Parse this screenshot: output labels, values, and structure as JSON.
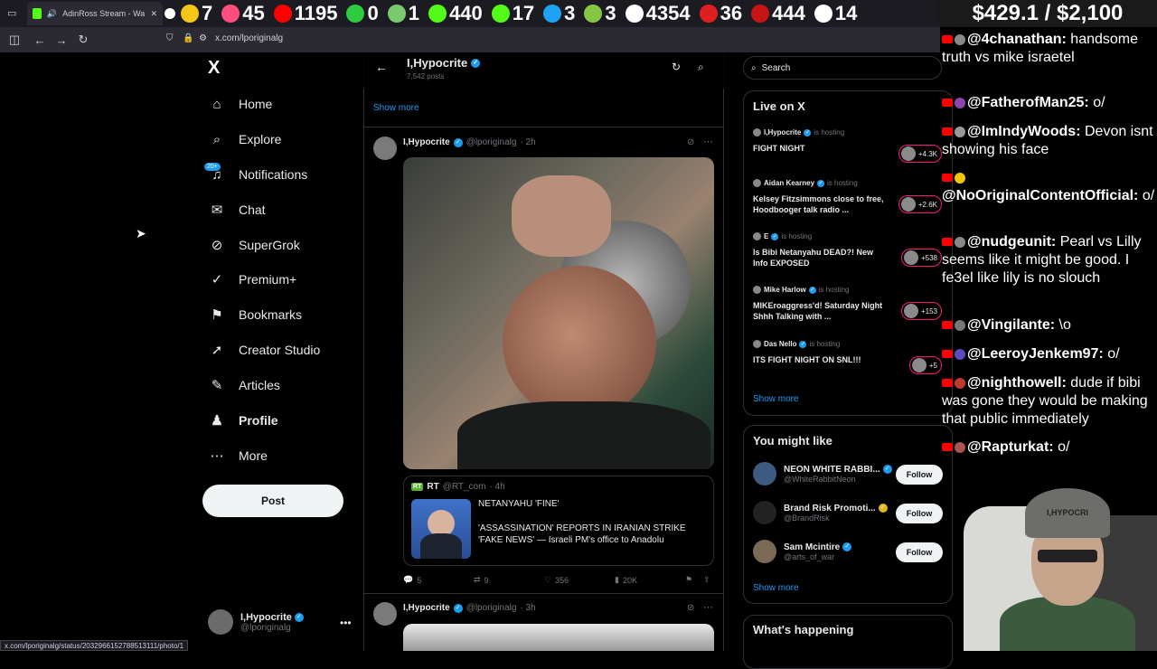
{
  "browser": {
    "active_tab_title": "AdinRoss Stream - Watch L",
    "url": "x.com/lporiginalg",
    "status_url": "x.com/lporiginalg/status/2032966152788513111/photo/1"
  },
  "overlay_stats": [
    {
      "icon": "smile-icon",
      "value": "7",
      "color": "#f5c518"
    },
    {
      "icon": "star-x-icon",
      "value": "45",
      "color": "#ff4d7e"
    },
    {
      "icon": "youtube-icon",
      "value": "1195",
      "color": "#ff0000"
    },
    {
      "icon": "plus-icon",
      "value": "0",
      "color": "#2ecc40"
    },
    {
      "icon": "globe-icon",
      "value": "1",
      "color": "#7bc96f"
    },
    {
      "icon": "play-icon",
      "value": "440",
      "color": "#53fc18"
    },
    {
      "icon": "kick-icon",
      "value": "17",
      "color": "#53fc18"
    },
    {
      "icon": "moon-icon",
      "value": "3",
      "color": "#1da1f2"
    },
    {
      "icon": "rumble-icon",
      "value": "3",
      "color": "#85c742"
    },
    {
      "icon": "x-icon",
      "value": "4354",
      "color": "#ffffff"
    },
    {
      "icon": "circle-icon",
      "value": "36",
      "color": "#e02020"
    },
    {
      "icon": "cross-icon",
      "value": "444",
      "color": "#c81414"
    },
    {
      "icon": "grid-icon",
      "value": "14",
      "color": "#ffffff"
    }
  ],
  "money": "$429.1 / $2,100",
  "nav": {
    "logo": "X",
    "items": [
      {
        "icon": "home-icon",
        "glyph": "⌂",
        "label": "Home"
      },
      {
        "icon": "search-icon",
        "glyph": "⌕",
        "label": "Explore"
      },
      {
        "icon": "bell-icon",
        "glyph": "♫",
        "label": "Notifications"
      },
      {
        "icon": "mail-icon",
        "glyph": "✉",
        "label": "Chat"
      },
      {
        "icon": "grok-icon",
        "glyph": "⊘",
        "label": "SuperGrok"
      },
      {
        "icon": "premium-icon",
        "glyph": "✓",
        "label": "Premium+"
      },
      {
        "icon": "bookmark-icon",
        "glyph": "⚑",
        "label": "Bookmarks"
      },
      {
        "icon": "rocket-icon",
        "glyph": "➚",
        "label": "Creator Studio"
      },
      {
        "icon": "articles-icon",
        "glyph": "✎",
        "label": "Articles"
      },
      {
        "icon": "person-icon",
        "glyph": "♟",
        "label": "Profile"
      },
      {
        "icon": "more-icon",
        "glyph": "⋯",
        "label": "More"
      }
    ],
    "notif_badge": "20+",
    "post_label": "Post",
    "account_name": "I,Hypocrite",
    "account_handle": "@lporiginalg"
  },
  "timeline": {
    "title": "I,Hypocrite",
    "posts_count": "7,542 posts",
    "show_more": "Show more",
    "tweet1": {
      "name": "I,Hypocrite",
      "handle": "@lporiginalg",
      "time": "· 2h",
      "quote": {
        "logo": "RT",
        "name": "RT",
        "handle": "@RT_com",
        "time": "· 4h",
        "line1": "NETANYAHU 'FINE'",
        "line2": "'ASSASSINATION' REPORTS IN IRANIAN STRIKE 'FAKE NEWS' — Israeli PM's office to Anadolu"
      },
      "replies": "5",
      "reposts": "9",
      "likes": "356",
      "views": "20K"
    },
    "tweet2": {
      "name": "I,Hypocrite",
      "handle": "@lporiginalg",
      "time": "· 3h"
    }
  },
  "right": {
    "search_placeholder": "Search",
    "live_title": "Live on X",
    "live": [
      {
        "host": "I,Hypocrite",
        "hosting": "is hosting",
        "title": "FIGHT NIGHT",
        "count": "+4.3K"
      },
      {
        "host": "Aidan Kearney",
        "hosting": "is hosting",
        "title": "Kelsey Fitzsimmons close to free, Hoodbooger talk radio ...",
        "count": "+2.6K"
      },
      {
        "host": "E",
        "hosting": "is hosting",
        "title": "Is Bibi Netanyahu DEAD?! New Info EXPOSED",
        "count": "+538"
      },
      {
        "host": "Mike Harlow",
        "hosting": "is hosting",
        "title": "MIKEroaggress'd! Saturday Night Shhh Talking with ...",
        "count": "+153"
      },
      {
        "host": "Das Nello",
        "hosting": "is hosting",
        "title": "ITS FIGHT NIGHT ON SNL!!!",
        "count": "+5"
      }
    ],
    "live_show_more": "Show more",
    "wtf_title": "You might like",
    "wtf": [
      {
        "name": "NEON WHITE RABBI...",
        "handle": "@WhiteRabbitNeon",
        "follow": "Follow"
      },
      {
        "name": "Brand Risk Promoti...",
        "handle": "@BrandRisk",
        "follow": "Follow"
      },
      {
        "name": "Sam Mcintire",
        "handle": "@arts_of_war",
        "follow": "Follow"
      }
    ],
    "wtf_show_more": "Show more",
    "happening_title": "What's happening"
  },
  "chat": [
    {
      "user": "@4chanathan",
      "msg": "handsome truth vs mike israetel"
    },
    {
      "user": "@FatherofMan25",
      "msg": "o/"
    },
    {
      "user": "@ImIndyWoods",
      "msg": "Devon isnt showing his face"
    },
    {
      "user": "@NoOriginalContentOfficial",
      "msg": "o/"
    },
    {
      "user": "@nudgeunit",
      "msg": "Pearl vs Lilly seems like it might be good. I fe3el like lily is no slouch"
    },
    {
      "user": "@Vingilante",
      "msg": "\\o"
    },
    {
      "user": "@LeeroyJenkem97",
      "msg": "o/"
    },
    {
      "user": "@nighthowell",
      "msg": "dude if bibi was gone they would be making that public immediately"
    },
    {
      "user": "@Rapturkat",
      "msg": "o/"
    }
  ],
  "webcam_hat_text": "I,HYPOCRI"
}
